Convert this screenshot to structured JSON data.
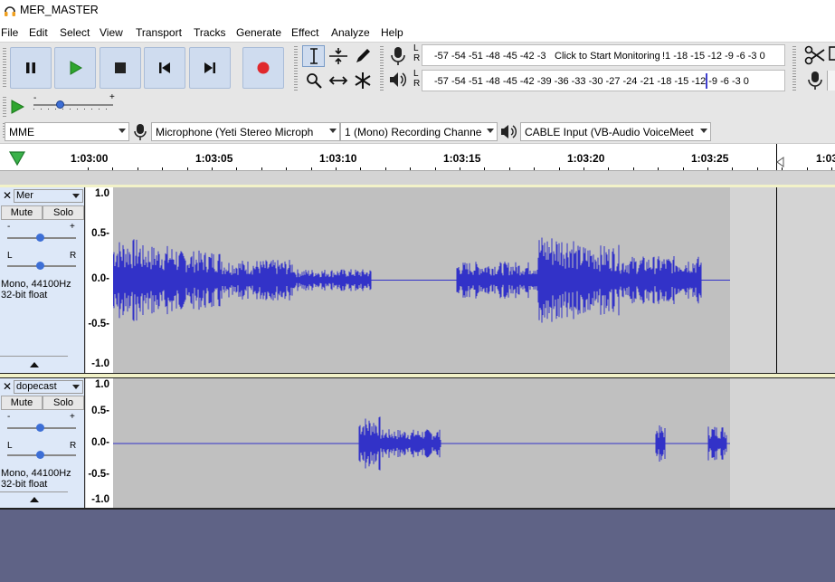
{
  "window": {
    "title": "MER_MASTER",
    "icon": "headphones-icon"
  },
  "menu": [
    "File",
    "Edit",
    "Select",
    "View",
    "Transport",
    "Tracks",
    "Generate",
    "Effect",
    "Analyze",
    "Help"
  ],
  "transport": {
    "buttons": [
      "pause-icon",
      "play-icon",
      "stop-icon",
      "skip-start-icon",
      "skip-end-icon",
      "record-icon"
    ]
  },
  "meters": {
    "monitor_prompt": "Click to Start Monitoring",
    "rec_scale_left": "-57 -54 -51 -48 -45 -42 -3",
    "rec_scale_right": "!1 -18 -15 -12  -9  -6  -3  0",
    "play_scale": "-57 -54 -51 -48 -45 -42 -39 -36 -33 -30 -27 -24 -21 -18 -15 -12  -9  -6  -3  0",
    "lr_top": "L",
    "lr_bottom": "R"
  },
  "devices": {
    "host": "MME",
    "recording_device": "Microphone (Yeti Stereo Microph",
    "recording_channels": "1 (Mono) Recording Channe",
    "playback_device": "CABLE Input (VB-Audio VoiceMeet"
  },
  "timeline": {
    "labels": [
      "1:03:00",
      "1:03:05",
      "1:03:10",
      "1:03:15",
      "1:03:20",
      "1:03:25",
      "1:03"
    ]
  },
  "tracks": [
    {
      "name": "Mer",
      "mute_label": "Mute",
      "solo_label": "Solo",
      "gain_minus": "-",
      "gain_plus": "+",
      "pan_left": "L",
      "pan_right": "R",
      "info_line1": "Mono, 44100Hz",
      "info_line2": "32-bit float",
      "scale": [
        "1.0",
        "0.5-",
        "0.0-",
        "-0.5-",
        "-1.0"
      ]
    },
    {
      "name": "dopecast",
      "mute_label": "Mute",
      "solo_label": "Solo",
      "gain_minus": "-",
      "gain_plus": "+",
      "pan_left": "L",
      "pan_right": "R",
      "info_line1": "Mono, 44100Hz",
      "info_line2": "32-bit float",
      "scale": [
        "1.0",
        "0.5-",
        "0.0-",
        "-0.5-",
        "-1.0"
      ]
    }
  ],
  "colors": {
    "waveform": "#3232c8",
    "record": "#e0282d",
    "play": "#2fa52f",
    "accent": "#cfdcef"
  }
}
